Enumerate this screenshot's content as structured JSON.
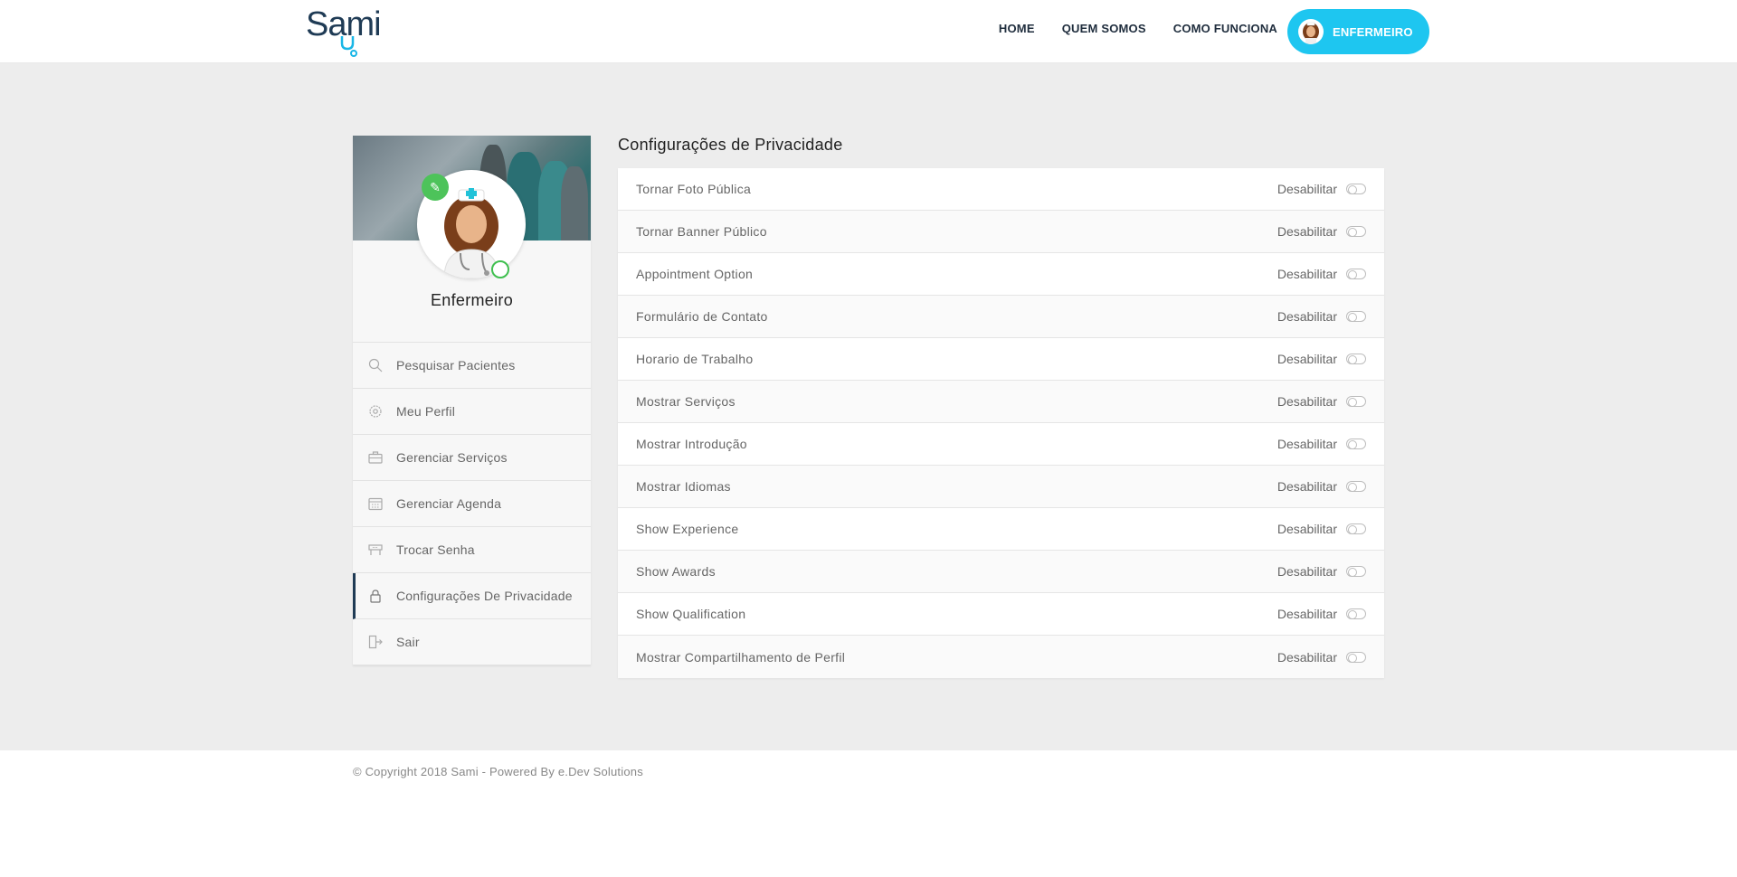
{
  "header": {
    "logo": "Sami",
    "nav": [
      "HOME",
      "QUEM SOMOS",
      "COMO FUNCIONA"
    ],
    "user_button": "ENFERMEIRO"
  },
  "sidebar": {
    "profile_name": "Enfermeiro",
    "items": [
      {
        "label": "Pesquisar Pacientes",
        "icon": "search-icon"
      },
      {
        "label": "Meu Perfil",
        "icon": "gear-icon"
      },
      {
        "label": "Gerenciar Serviços",
        "icon": "briefcase-icon"
      },
      {
        "label": "Gerenciar Agenda",
        "icon": "calendar-icon"
      },
      {
        "label": "Trocar Senha",
        "icon": "key-icon"
      },
      {
        "label": "Configurações De Privacidade",
        "icon": "lock-icon",
        "active": true
      },
      {
        "label": "Sair",
        "icon": "logout-icon"
      }
    ]
  },
  "main": {
    "title": "Configurações de Privacidade",
    "settings": [
      {
        "label": "Tornar Foto Pública",
        "status": "Desabilitar"
      },
      {
        "label": "Tornar Banner Público",
        "status": "Desabilitar"
      },
      {
        "label": "Appointment Option",
        "status": "Desabilitar"
      },
      {
        "label": "Formulário de Contato",
        "status": "Desabilitar"
      },
      {
        "label": "Horario de Trabalho",
        "status": "Desabilitar"
      },
      {
        "label": "Mostrar Serviços",
        "status": "Desabilitar"
      },
      {
        "label": "Mostrar Introdução",
        "status": "Desabilitar"
      },
      {
        "label": "Mostrar Idiomas",
        "status": "Desabilitar"
      },
      {
        "label": "Show Experience",
        "status": "Desabilitar"
      },
      {
        "label": "Show Awards",
        "status": "Desabilitar"
      },
      {
        "label": "Show Qualification",
        "status": "Desabilitar"
      },
      {
        "label": "Mostrar Compartilhamento de Perfil",
        "status": "Desabilitar"
      }
    ]
  },
  "footer": {
    "copyright": "© Copyright 2018 Sami - Powered By e.Dev Solutions"
  },
  "colors": {
    "accent": "#1ec6f0",
    "brand_dark": "#1f3b55",
    "online": "#3fbf4f",
    "edit": "#4dc35a"
  }
}
